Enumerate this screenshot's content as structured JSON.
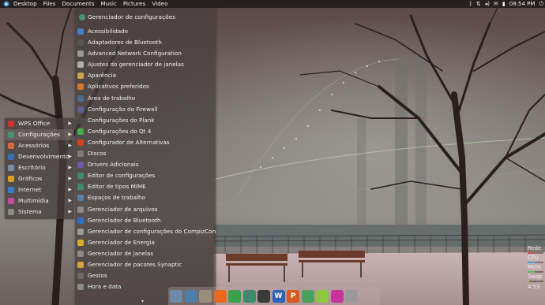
{
  "top_panel": {
    "menu": [
      "Desktop",
      "Files",
      "Documents",
      "Music",
      "Pictures",
      "Video"
    ],
    "clock": "08:54 PM",
    "tray_icons": [
      "bluetooth-icon",
      "network-icon",
      "volume-icon",
      "indicator-icon",
      "battery-icon",
      "power-icon"
    ]
  },
  "category_menu": {
    "items": [
      {
        "label": "WPS Office",
        "icon": "wps-office-icon",
        "color": "#c8372d"
      },
      {
        "label": "Configurações",
        "icon": "settings-icon",
        "color": "#4a8f78",
        "active": true
      },
      {
        "label": "Acessórios",
        "icon": "accessories-icon",
        "color": "#d06a3a"
      },
      {
        "label": "Desenvolvimento",
        "icon": "development-icon",
        "color": "#3d6fb0"
      },
      {
        "label": "Escritório",
        "icon": "office-icon",
        "color": "#7d8ea3"
      },
      {
        "label": "Gráficos",
        "icon": "graphics-icon",
        "color": "#d9a12b"
      },
      {
        "label": "Internet",
        "icon": "internet-icon",
        "color": "#3b7ec8"
      },
      {
        "label": "Multimídia",
        "icon": "multimedia-icon",
        "color": "#c04d9a"
      },
      {
        "label": "Sistema",
        "icon": "system-icon",
        "color": "#8a8a8a"
      }
    ]
  },
  "sub_menu": {
    "header": "Gerenciador de configurações",
    "items": [
      {
        "label": "Acessibilidade",
        "icon": "accessibility-icon",
        "color": "#3f7fc4"
      },
      {
        "label": "Adaptadores de Bluetooth",
        "icon": "bluetooth-icon",
        "color": "#555555"
      },
      {
        "label": "Advanced Network Configuration",
        "icon": "network-icon",
        "color": "#9a9a9a"
      },
      {
        "label": "Ajustes do gerenciador de janelas",
        "icon": "window-tweaks-icon",
        "color": "#b0b0b0"
      },
      {
        "label": "Aparência",
        "icon": "appearance-icon",
        "color": "#c9a54c"
      },
      {
        "label": "Aplicativos preferidos",
        "icon": "preferred-apps-icon",
        "color": "#d27a2c"
      },
      {
        "label": "Área de trabalho",
        "icon": "desktop-icon",
        "color": "#4d6d8e"
      },
      {
        "label": "Configuração do Firewall",
        "icon": "firewall-icon",
        "color": "#5f5f8f"
      },
      {
        "label": "Configurações do Plank",
        "icon": "plank-icon",
        "color": "#4a4a4a"
      },
      {
        "label": "Configurações do Qt 4",
        "icon": "qt-icon",
        "color": "#41b04a"
      },
      {
        "label": "Configurador de Alternativas",
        "icon": "alternatives-icon",
        "color": "#d0451f"
      },
      {
        "label": "Discos",
        "icon": "disks-icon",
        "color": "#7b7b7b"
      },
      {
        "label": "Drivers Adicionais",
        "icon": "drivers-icon",
        "color": "#6a58a8"
      },
      {
        "label": "Editor de configurações",
        "icon": "config-editor-icon",
        "color": "#3e8a6e"
      },
      {
        "label": "Editor de tipos MIME",
        "icon": "mime-editor-icon",
        "color": "#3e8a6e"
      },
      {
        "label": "Espaços de trabalho",
        "icon": "workspaces-icon",
        "color": "#5a7fa6"
      },
      {
        "label": "Gerenciador de arquivos",
        "icon": "file-manager-icon",
        "color": "#8a8a8a"
      },
      {
        "label": "Gerenciador de Bluetooth",
        "icon": "bluetooth-manager-icon",
        "color": "#2f6fc0"
      },
      {
        "label": "Gerenciador de configurações do CompizConfig",
        "icon": "compiz-icon",
        "color": "#9a9a9a"
      },
      {
        "label": "Gerenciador de Energia",
        "icon": "power-manager-icon",
        "color": "#d6b02c"
      },
      {
        "label": "Gerenciador de janelas",
        "icon": "window-manager-icon",
        "color": "#8c8c8c"
      },
      {
        "label": "Gerenciador de pacotes Synaptic",
        "icon": "synaptic-icon",
        "color": "#d6a23a"
      },
      {
        "label": "Gestos",
        "icon": "gestures-icon",
        "color": "#6a6a6a"
      },
      {
        "label": "Hora e data",
        "icon": "time-date-icon",
        "color": "#8a8a8a"
      }
    ],
    "scroll_indicator": "▾"
  },
  "dock": {
    "items": [
      {
        "name": "dock-file-manager-icon",
        "glyph": "",
        "color": "#6f8aa8"
      },
      {
        "name": "dock-network-icon",
        "glyph": "",
        "color": "#4e7fa8"
      },
      {
        "name": "dock-downloads-icon",
        "glyph": "",
        "color": "#9a8e7a"
      },
      {
        "name": "dock-firefox-icon",
        "glyph": "",
        "color": "#e66a1d"
      },
      {
        "name": "dock-chrome-icon",
        "glyph": "",
        "color": "#3aa04a"
      },
      {
        "name": "dock-settings-icon",
        "glyph": "",
        "color": "#3e8a6e"
      },
      {
        "name": "dock-terminal-icon",
        "glyph": "",
        "color": "#3a3a3a"
      },
      {
        "name": "dock-wps-writer-icon",
        "glyph": "W",
        "color": "#2f63b8"
      },
      {
        "name": "dock-wps-presentation-icon",
        "glyph": "P",
        "color": "#d85a1e"
      },
      {
        "name": "dock-software-center-icon",
        "glyph": "",
        "color": "#4aa35a"
      },
      {
        "name": "dock-package-icon",
        "glyph": "",
        "color": "#8ec63f"
      },
      {
        "name": "dock-games-icon",
        "glyph": "",
        "color": "#c8359a"
      },
      {
        "name": "dock-trash-icon",
        "glyph": "",
        "color": "#9a9a9a"
      }
    ]
  },
  "system_monitor": {
    "rows": [
      {
        "label": "Rede",
        "color": "#d05050",
        "level": 0.4
      },
      {
        "label": "CPU",
        "color": "#4aa0e0",
        "level": 0.5
      },
      {
        "label": "Mem",
        "color": "#5cc05c",
        "level": 0.45
      },
      {
        "label": "Swap",
        "color": "#d0b040",
        "level": 0.1
      }
    ],
    "time": "4:53"
  }
}
